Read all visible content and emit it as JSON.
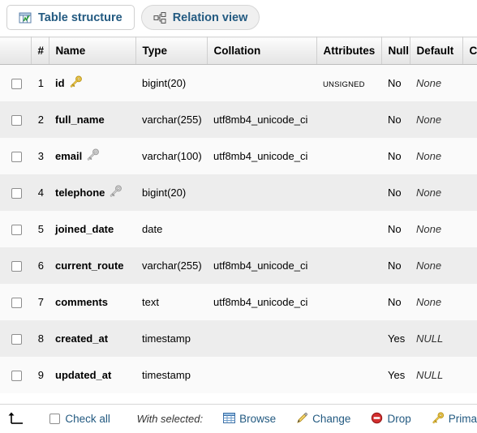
{
  "tabs": [
    {
      "label": "Table structure",
      "icon": "table-structure-icon",
      "active": true
    },
    {
      "label": "Relation view",
      "icon": "relation-view-icon",
      "active": false
    }
  ],
  "table": {
    "headers": {
      "checkbox": "",
      "number": "#",
      "name": "Name",
      "type": "Type",
      "collation": "Collation",
      "attributes": "Attributes",
      "null": "Null",
      "default": "Default",
      "extra": "C"
    },
    "rows": [
      {
        "num": "1",
        "name": "id",
        "key": "primary",
        "type": "bigint(20)",
        "collation": "",
        "attributes": "UNSIGNED",
        "null": "No",
        "default": "None"
      },
      {
        "num": "2",
        "name": "full_name",
        "key": "none",
        "type": "varchar(255)",
        "collation": "utf8mb4_unicode_ci",
        "attributes": "",
        "null": "No",
        "default": "None"
      },
      {
        "num": "3",
        "name": "email",
        "key": "unique",
        "type": "varchar(100)",
        "collation": "utf8mb4_unicode_ci",
        "attributes": "",
        "null": "No",
        "default": "None"
      },
      {
        "num": "4",
        "name": "telephone",
        "key": "unique",
        "type": "bigint(20)",
        "collation": "",
        "attributes": "",
        "null": "No",
        "default": "None"
      },
      {
        "num": "5",
        "name": "joined_date",
        "key": "none",
        "type": "date",
        "collation": "",
        "attributes": "",
        "null": "No",
        "default": "None"
      },
      {
        "num": "6",
        "name": "current_route",
        "key": "none",
        "type": "varchar(255)",
        "collation": "utf8mb4_unicode_ci",
        "attributes": "",
        "null": "No",
        "default": "None"
      },
      {
        "num": "7",
        "name": "comments",
        "key": "none",
        "type": "text",
        "collation": "utf8mb4_unicode_ci",
        "attributes": "",
        "null": "No",
        "default": "None"
      },
      {
        "num": "8",
        "name": "created_at",
        "key": "none",
        "type": "timestamp",
        "collation": "",
        "attributes": "",
        "null": "Yes",
        "default": "NULL"
      },
      {
        "num": "9",
        "name": "updated_at",
        "key": "none",
        "type": "timestamp",
        "collation": "",
        "attributes": "",
        "null": "Yes",
        "default": "NULL"
      }
    ]
  },
  "actionbar": {
    "check_all_label": "Check all",
    "with_selected_label": "With selected:",
    "actions": [
      {
        "label": "Browse",
        "icon": "browse-icon"
      },
      {
        "label": "Change",
        "icon": "pencil-icon"
      },
      {
        "label": "Drop",
        "icon": "drop-icon"
      },
      {
        "label": "Prima",
        "icon": "primary-key-icon"
      }
    ]
  },
  "colors": {
    "link": "#235a81",
    "row_even": "#ededed",
    "row_odd": "#fafafa",
    "primary_key": "#e8c14a",
    "unique_key": "#b9b9b9",
    "drop_red": "#cc2222"
  }
}
